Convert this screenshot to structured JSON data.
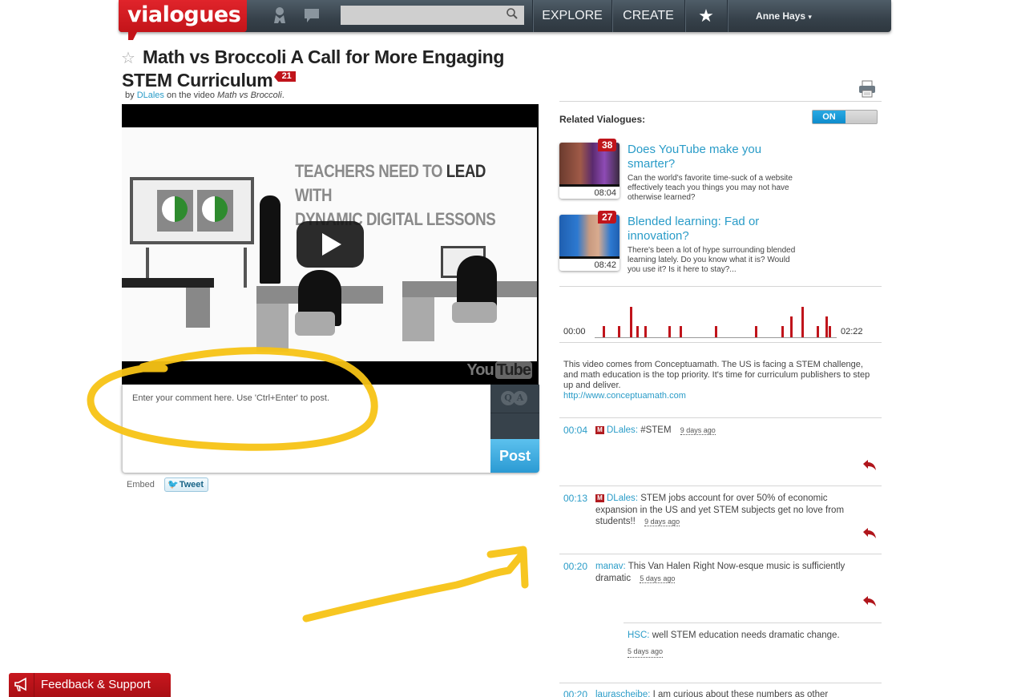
{
  "nav": {
    "logo": "vialogues",
    "search_placeholder": "",
    "search_value": "",
    "explore": "EXPLORE",
    "create": "CREATE",
    "user": "Anne Hays",
    "user_caret": "▾",
    "icons": {
      "profile": "person-icon",
      "messages": "chat-icon",
      "search": "search-icon",
      "favorites": "star-icon"
    }
  },
  "header": {
    "title": "Math vs Broccoli A Call for More Engaging STEM Curriculum",
    "comment_count": "21",
    "by_prefix": "by",
    "author": "DLales",
    "video_prefix": "on the video",
    "video_title": "Math vs Broccoli",
    "video_suffix": "."
  },
  "video": {
    "headline_a": "TEACHERS NEED TO ",
    "headline_bold": "LEAD",
    "headline_b": " WITH",
    "headline_c": "DYNAMIC DIGITAL LESSONS",
    "provider": "You",
    "provider_box": "Tube"
  },
  "composer": {
    "placeholder": "Enter your comment here. Use 'Ctrl+Enter' to post.",
    "value": "",
    "qa_q": "Q",
    "qa_a": "A",
    "post_label": "Post"
  },
  "share": {
    "embed_label": "Embed",
    "tweet_label": "Tweet"
  },
  "related": {
    "label": "Related Vialogues:",
    "toggle_label": "ON",
    "toggle_state": "on",
    "items": [
      {
        "count": "38",
        "duration": "08:04",
        "title": "Does YouTube make you smarter?",
        "description": "Can the world's favorite time-suck of a website effectively teach you things you may not have otherwise learned?"
      },
      {
        "count": "27",
        "duration": "08:42",
        "title": "Blended learning: Fad or innovation?",
        "description": "There's been a lot of hype surrounding blended learning lately. Do you know what it is? Would you use it? Is it here to stay?..."
      }
    ]
  },
  "timeline": {
    "start_label": "00:00",
    "end_label": "02:22",
    "duration_seconds": 142,
    "marks": [
      {
        "t": 4,
        "count": 1
      },
      {
        "t": 13,
        "count": 1
      },
      {
        "t": 20,
        "count": 3
      },
      {
        "t": 24,
        "count": 1
      },
      {
        "t": 29,
        "count": 1
      },
      {
        "t": 43,
        "count": 1
      },
      {
        "t": 50,
        "count": 1
      },
      {
        "t": 71,
        "count": 1
      },
      {
        "t": 95,
        "count": 1
      },
      {
        "t": 111,
        "count": 1
      },
      {
        "t": 116,
        "count": 2
      },
      {
        "t": 123,
        "count": 3
      },
      {
        "t": 132,
        "count": 1
      },
      {
        "t": 137,
        "count": 2
      },
      {
        "t": 139,
        "count": 1
      }
    ]
  },
  "description": {
    "text": "This video comes from Conceptuamath. The US is facing a STEM challenge, and math education is the top priority. It's time for curriculum publishers to step up and deliver.",
    "link": "http://www.conceptuamath.com"
  },
  "comments": [
    {
      "time": "00:04",
      "moderator": true,
      "badge": "M",
      "author": "DLales",
      "text": "#STEM",
      "ago": "9 days ago"
    },
    {
      "time": "00:13",
      "moderator": true,
      "badge": "M",
      "author": "DLales",
      "text": "STEM jobs account for over 50% of economic expansion in the US and yet STEM subjects get no love from students!!",
      "ago": "9 days ago"
    },
    {
      "time": "00:20",
      "moderator": false,
      "badge": "",
      "author": "manav",
      "text": "This Van Halen Right Now-esque music is sufficiently dramatic",
      "ago": "5 days ago",
      "replies": [
        {
          "author": "HSC",
          "text": "well STEM education needs dramatic change.",
          "ago": "5 days ago"
        }
      ]
    },
    {
      "time": "00:20",
      "moderator": false,
      "badge": "",
      "author": "laurascheibe",
      "text": "I am curious about these numbers as other",
      "ago": ""
    }
  ],
  "feedback": {
    "label": "Feedback & Support"
  },
  "colors": {
    "brand_red": "#c0141b",
    "link_blue": "#2a9cc8",
    "post_blue": "#2b9ad3",
    "nav_dark": "#36414a",
    "annotation_yellow": "#f7c315"
  }
}
